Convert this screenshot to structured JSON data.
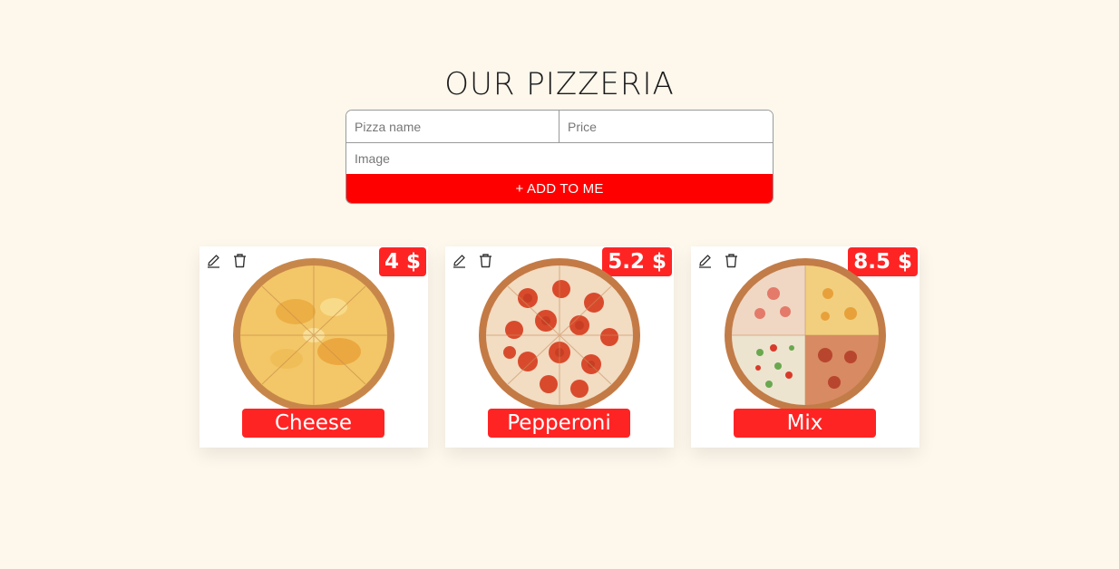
{
  "page": {
    "title": "OUR PIZZERIA"
  },
  "form": {
    "name_placeholder": "Pizza name",
    "price_placeholder": "Price",
    "image_placeholder": "Image",
    "add_label": "+ ADD TO ME"
  },
  "pizzas": [
    {
      "name": "Cheese",
      "price": "4 $"
    },
    {
      "name": "Pepperoni",
      "price": "5.2 $"
    },
    {
      "name": "Mix",
      "price": "8.5 $"
    }
  ],
  "icons": {
    "edit": "pencil-icon",
    "delete": "trash-icon"
  },
  "colors": {
    "accent": "#ff0000",
    "badge": "#ff2424",
    "background": "#fdf7ec"
  }
}
